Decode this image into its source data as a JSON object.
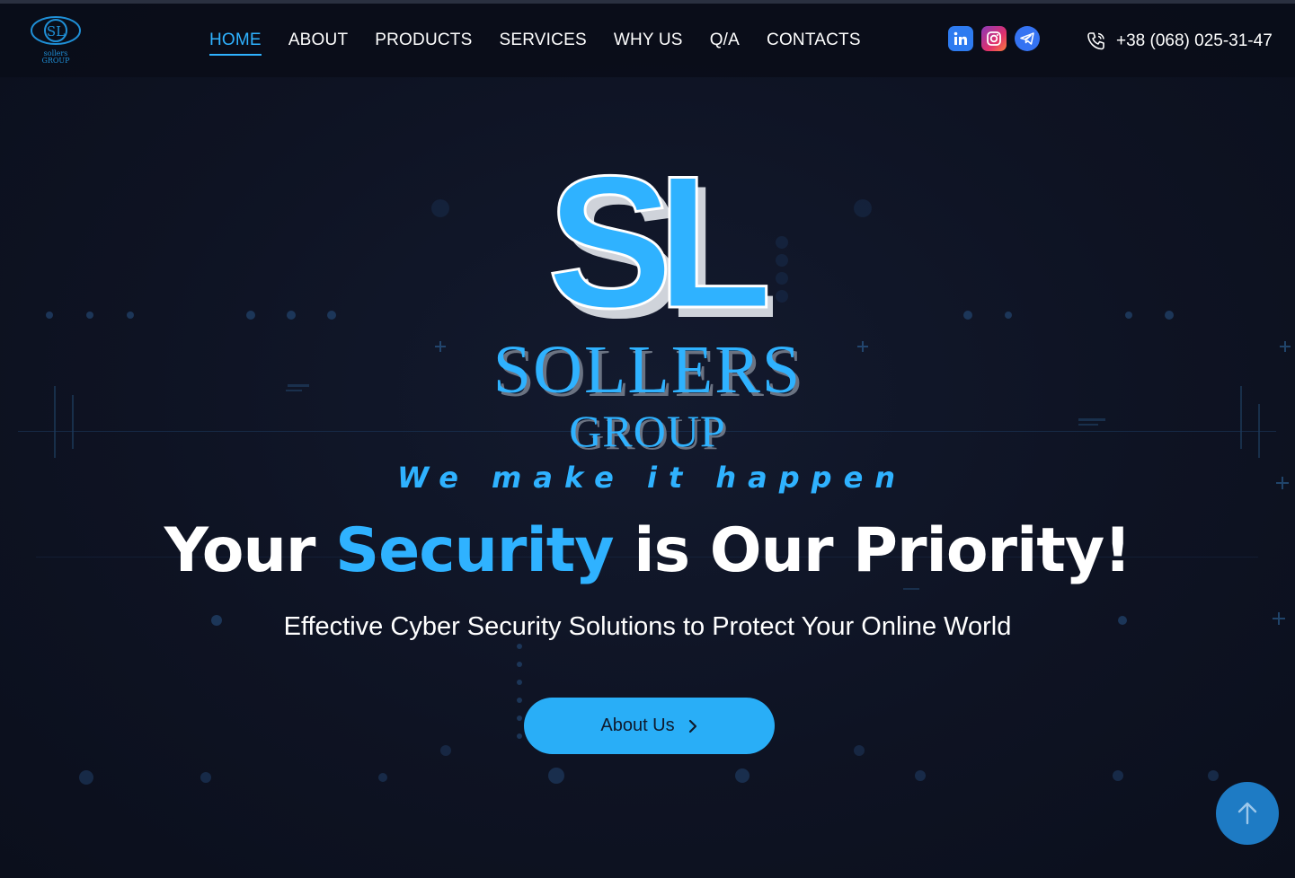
{
  "nav": {
    "items": [
      {
        "label": "HOME",
        "active": true
      },
      {
        "label": "ABOUT"
      },
      {
        "label": "PRODUCTS"
      },
      {
        "label": "SERVICES"
      },
      {
        "label": "WHY US"
      },
      {
        "label": "Q/A"
      },
      {
        "label": "CONTACTS"
      }
    ]
  },
  "logo": {
    "monogram": "SL",
    "line1": "sollers",
    "line2": "GROUP"
  },
  "socials": [
    {
      "icon": "linkedin-icon"
    },
    {
      "icon": "instagram-icon"
    },
    {
      "icon": "telegram-icon"
    }
  ],
  "contact": {
    "phone": "+38 (068) 025-31-47",
    "icon": "phone-icon"
  },
  "hero": {
    "monogram": "SL",
    "brand": "SOLLERS",
    "brand_sub": "GROUP",
    "tagline": "We make it happen",
    "headline_before": "Your ",
    "headline_accent": "Security",
    "headline_after": " is Our Priority!",
    "subtitle": "Effective Cyber Security Solutions to Protect Your Online World",
    "cta_label": "About Us"
  },
  "colors": {
    "accent": "#2fb2ff",
    "background": "#0d1222",
    "button": "#29aef7",
    "scroll_top": "#1e7bc4"
  }
}
